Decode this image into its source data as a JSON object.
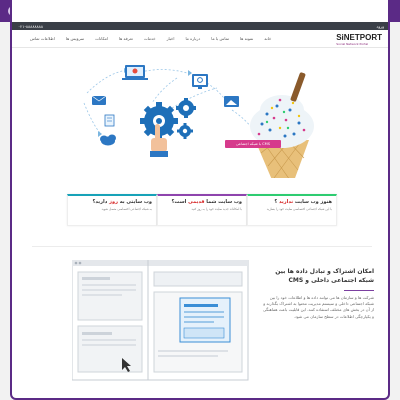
{
  "window": {
    "accent": "#5b2a86"
  },
  "topbar": {
    "phone": "۰۲۱-۸۸۸۸۸۸۸۸",
    "right_label": "ورود"
  },
  "logo": {
    "brand": "SiNETPORT",
    "tagline": "Social Network Portal"
  },
  "menu": {
    "items": [
      "خانه",
      "نمونه ها",
      "تماس با ما",
      "درباره ما",
      "اخبار",
      "خدمات",
      "تعرفه ها",
      "امکانات",
      "سرویس ها",
      "اطلاعات تماس"
    ]
  },
  "hero": {
    "cms_label": "CMS با شبکه اجتماعی",
    "colors": {
      "gear": "#1e6fb8",
      "cone": "#e8c07a",
      "pink": "#d63a8c"
    }
  },
  "cards": [
    {
      "title": "هنوز وب سایت ",
      "highlight": "ندارید",
      "title_end": " ؟",
      "text": "با این شبکه اجتماعی اختصاصی سایت خود را بسازید",
      "color": "#2ecc71"
    },
    {
      "title": "وب سایت شما ",
      "highlight": "قدیمی",
      "title_end": " است؟",
      "text": "با امکانات جدید سایت خود را به روز کنید",
      "color": "#8e44ad"
    },
    {
      "title": "وب سایتی به ",
      "highlight": "روز",
      "title_end": " دارید؟",
      "text": "به شبکه اجتماعی اختصاصی متصل شوید",
      "color": "#17a2b8"
    }
  ],
  "feature": {
    "title": "امکان اشتراک و تبادل داده ها بین شبکه اجتماعی داخلی و CMS",
    "body": "شرکت ها و سازمان ها می توانند داده ها و اطلاعات خود را بین شبکه اجتماعی داخلی و سیستم مدیریت محتوا به اشتراک بگذارند و از آن در بخش های مختلف استفاده کنند. این قابلیت باعث هماهنگی و یکپارچگی اطلاعات در سطح سازمان می شود."
  }
}
